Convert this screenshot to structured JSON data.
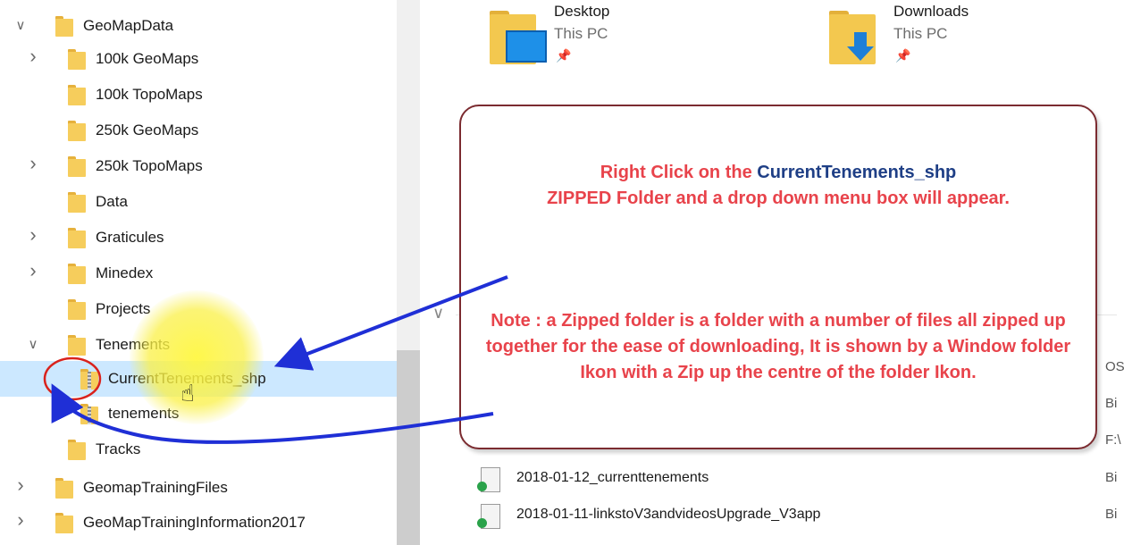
{
  "nav": {
    "items": [
      {
        "label": "GeoMapData",
        "chevron": "expanded",
        "icon": "folder-icon"
      },
      {
        "label": "100k GeoMaps",
        "chevron": "collapsed",
        "icon": "folder-icon"
      },
      {
        "label": "100k TopoMaps",
        "chevron": "none",
        "icon": "folder-icon"
      },
      {
        "label": "250k GeoMaps",
        "chevron": "none",
        "icon": "folder-icon"
      },
      {
        "label": "250k TopoMaps",
        "chevron": "collapsed",
        "icon": "folder-icon"
      },
      {
        "label": "Data",
        "chevron": "none",
        "icon": "folder-icon"
      },
      {
        "label": "Graticules",
        "chevron": "collapsed",
        "icon": "folder-icon"
      },
      {
        "label": "Minedex",
        "chevron": "collapsed",
        "icon": "folder-icon"
      },
      {
        "label": "Projects",
        "chevron": "none",
        "icon": "folder-icon"
      },
      {
        "label": "Tenements",
        "chevron": "expanded",
        "icon": "folder-icon"
      },
      {
        "label": "CurrentTenements_shp",
        "chevron": "none",
        "icon": "zipped-folder-icon",
        "selected": true
      },
      {
        "label": "tenements",
        "chevron": "none",
        "icon": "zipped-folder-icon"
      },
      {
        "label": "Tracks",
        "chevron": "none",
        "icon": "folder-icon"
      },
      {
        "label": "GeomapTrainingFiles",
        "chevron": "collapsed",
        "icon": "folder-icon"
      },
      {
        "label": "GeoMapTrainingInformation2017",
        "chevron": "collapsed",
        "icon": "folder-icon"
      }
    ]
  },
  "quick_access": {
    "items": [
      {
        "title": "Desktop",
        "subtitle": "This PC",
        "icon": "desktop-folder-icon"
      },
      {
        "title": "Downloads",
        "subtitle": "This PC",
        "icon": "downloads-folder-icon"
      }
    ]
  },
  "files": {
    "rows": [
      {
        "name": "2018-01-12_currenttenements",
        "type": "Bi"
      },
      {
        "name": "2018-01-11-linkstoV3andvideosUpgrade_V3app",
        "type": "Bi"
      }
    ],
    "type_column_fragments": [
      "OS",
      "Bi",
      "F:\\"
    ]
  },
  "callout": {
    "heading_prefix": "Right Click  on the ",
    "heading_highlight": "CurrentTenements_shp",
    "heading_rest": "ZIPPED Folder and a drop down menu box will appear.",
    "note": "Note : a Zipped folder is a folder with a number of files all zipped up together for the ease of downloading, It is shown by a Window folder Ikon with a Zip up the centre of the folder Ikon."
  },
  "colors": {
    "callout_text": "#e8434b",
    "callout_highlight": "#1f3f86",
    "callout_border": "#7b2b30",
    "arrow": "#1f2fd6",
    "selection": "#cce8ff",
    "folder": "#f6cd5c"
  }
}
